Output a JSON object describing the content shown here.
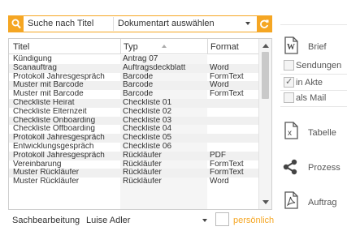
{
  "search": {
    "label": "Suche nach Titel"
  },
  "doctype": {
    "selected": "Dokumentart auswählen"
  },
  "colors": {
    "accent": "#f5a623"
  },
  "table": {
    "columns": [
      "Titel",
      "Typ",
      "Format"
    ],
    "rows": [
      [
        "Kündigung",
        "Antrag 07",
        ""
      ],
      [
        "Scanauftrag",
        "Auftragsdeckblatt",
        "Word"
      ],
      [
        "Protokoll Jahresgespräch",
        "Barcode",
        "FormText"
      ],
      [
        "Muster mit Barcode",
        "Barcode",
        "Word"
      ],
      [
        "Muster mit Barcode",
        "Barcode",
        "FormText"
      ],
      [
        "Checkliste Heirat",
        "Checkliste 01",
        ""
      ],
      [
        "Checkliste Elternzeit",
        "Checkliste 02",
        ""
      ],
      [
        "Checkliste Onboarding",
        "Checkliste 03",
        ""
      ],
      [
        "Checkliste Offboarding",
        "Checkliste 04",
        ""
      ],
      [
        "Protokoll Jahresgespräch",
        "Checkliste 05",
        ""
      ],
      [
        "Entwicklungsgespräch",
        "Checkliste 06",
        ""
      ],
      [
        "Protokoll Jahresgespräch",
        "Rückläufer",
        "PDF"
      ],
      [
        "Vereinbarung",
        "Rückläufer",
        "FormText"
      ],
      [
        "Muster Rückläufer",
        "Rückläufer",
        "FormText"
      ],
      [
        "Muster Rückläufer",
        "Rückläufer",
        "Word"
      ]
    ]
  },
  "clerk": {
    "label": "Sachbearbeitung",
    "value": "Luise Adler"
  },
  "personal": {
    "label": "persönlich"
  },
  "actions": {
    "brief": "Brief",
    "sendungen": "Sendungen",
    "in_akte": "in Akte",
    "als_mail": "als Mail",
    "tabelle": "Tabelle",
    "prozess": "Prozess",
    "auftrag": "Auftrag"
  },
  "icons": [
    "search-icon",
    "refresh-icon",
    "word-icon",
    "excel-icon",
    "share-icon",
    "pdf-icon"
  ]
}
